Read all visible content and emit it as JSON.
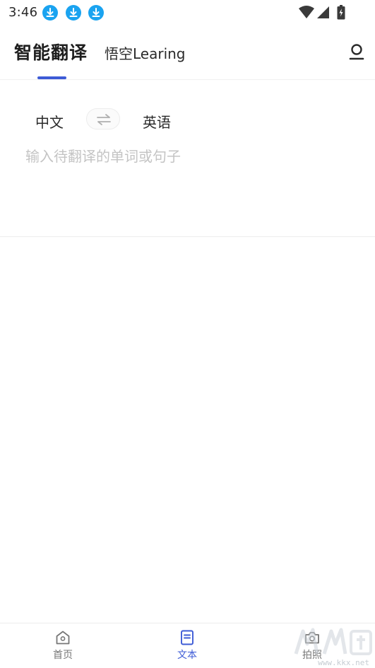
{
  "status_bar": {
    "time": "3:46",
    "notification_icons": [
      "download-icon",
      "download-icon",
      "download-icon"
    ],
    "accent_color": "#1aa3f0"
  },
  "header": {
    "active_tab": "智能翻译",
    "secondary_tab": "悟空Learing",
    "indicator_color": "#3d5bd6"
  },
  "translate": {
    "source_lang": "中文",
    "target_lang": "英语",
    "input_placeholder": "输入待翻译的单词或句子",
    "input_value": ""
  },
  "bottom_nav": {
    "items": [
      {
        "label": "首页",
        "icon": "home-icon",
        "active": false
      },
      {
        "label": "文本",
        "icon": "document-icon",
        "active": true
      },
      {
        "label": "拍照",
        "icon": "camera-icon",
        "active": false
      }
    ],
    "active_color": "#3d5bd6"
  },
  "watermark": {
    "text": "www.kkx.net"
  }
}
